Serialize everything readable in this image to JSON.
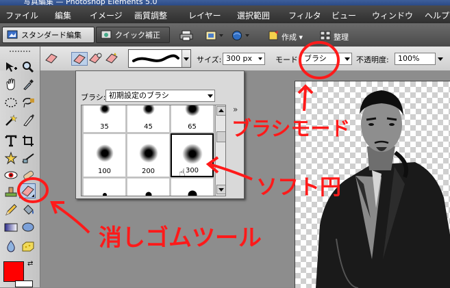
{
  "app": {
    "title": "写真編集 — Photoshop Elements 5.0"
  },
  "menu": [
    "ファイル",
    "編集",
    "イメージ",
    "画質調整",
    "レイヤー",
    "選択範囲",
    "フィルタ",
    "ビュー",
    "ウィンドウ",
    "ヘルプ"
  ],
  "mode_tabs": [
    {
      "label": "スタンダード編集",
      "active": true
    },
    {
      "label": "クイック補正",
      "active": false
    }
  ],
  "mode_actions": {
    "create_label": "作成",
    "organize_label": "整理"
  },
  "options": {
    "size_label": "サイズ:",
    "size_value": "300 px",
    "mode_label": "モード:",
    "mode_value": "ブラシ",
    "opacity_label": "不透明度:",
    "opacity_value": "100%"
  },
  "brush_picker": {
    "brush_label": "ブラシ:",
    "brush_set": "初期設定のブラシ",
    "more_label": "»",
    "brushes": [
      {
        "size": "35",
        "selected": false
      },
      {
        "size": "45",
        "selected": false
      },
      {
        "size": "65",
        "selected": false
      },
      {
        "size": "100",
        "selected": false
      },
      {
        "size": "200",
        "selected": false
      },
      {
        "size": "300",
        "selected": true
      }
    ]
  },
  "annotations": {
    "brush_mode": "ブラシモード",
    "soft_round": "ソフト円",
    "eraser_tool": "消しゴムツール",
    "color": "#ff1a1a"
  },
  "colors": {
    "foreground": "#ff0000",
    "background": "#ffffff"
  }
}
